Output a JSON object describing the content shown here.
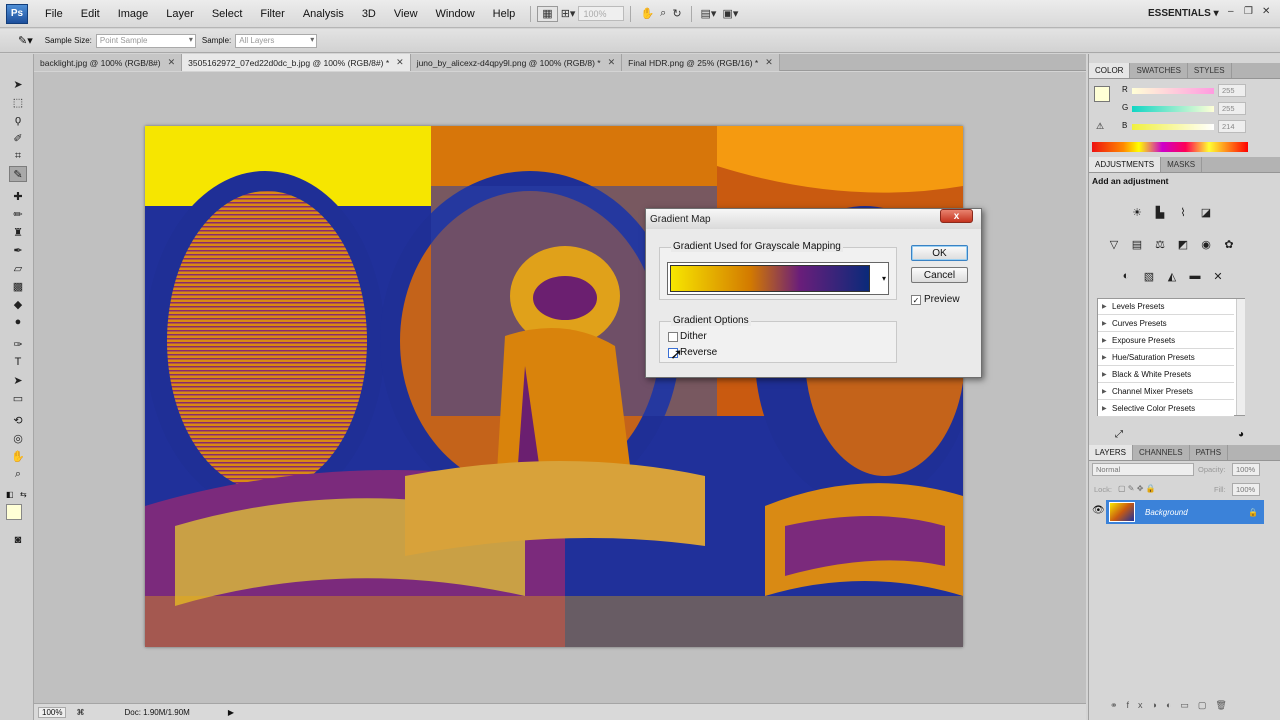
{
  "menubar": {
    "logo": "Ps",
    "items": [
      "File",
      "Edit",
      "Image",
      "Layer",
      "Select",
      "Filter",
      "Analysis",
      "3D",
      "View",
      "Window",
      "Help"
    ],
    "zoom_display": "100%",
    "workspace": "ESSENTIALS"
  },
  "options_bar": {
    "sample_size_label": "Sample Size:",
    "sample_size_value": "Point Sample",
    "sample_label": "Sample:",
    "sample_value": "All Layers"
  },
  "tabs": [
    {
      "label": "backlight.jpg @ 100% (RGB/8#)"
    },
    {
      "label": "3505162972_07ed22d0dc_b.jpg @ 100% (RGB/8#) *"
    },
    {
      "label": "juno_by_alicexz-d4qpy9l.png @ 100% (RGB/8) *"
    },
    {
      "label": "Final HDR.png @ 25% (RGB/16) *"
    }
  ],
  "status": {
    "zoom": "100%",
    "doc": "Doc: 1.90M/1.90M"
  },
  "color_panel": {
    "tabs": [
      "COLOR",
      "SWATCHES",
      "STYLES"
    ],
    "r_label": "R",
    "g_label": "G",
    "b_label": "B",
    "r": "255",
    "g": "255",
    "b": "214",
    "colors": {
      "fg": "#ffffd6",
      "r_grad": "#ff3b3b",
      "g_grad": "#3bd26a",
      "b_grad": "#ffe34a"
    }
  },
  "adjustments_panel": {
    "tabs": [
      "ADJUSTMENTS",
      "MASKS"
    ],
    "heading": "Add an adjustment",
    "presets": [
      "Levels Presets",
      "Curves Presets",
      "Exposure Presets",
      "Hue/Saturation Presets",
      "Black & White Presets",
      "Channel Mixer Presets",
      "Selective Color Presets"
    ]
  },
  "layers_panel": {
    "tabs": [
      "LAYERS",
      "CHANNELS",
      "PATHS"
    ],
    "blend_mode": "Normal",
    "opacity_label": "Opacity:",
    "opacity": "100%",
    "lock_label": "Lock:",
    "fill_label": "Fill:",
    "fill": "100%",
    "layers": [
      {
        "name": "Background"
      }
    ]
  },
  "dialog": {
    "title": "Gradient Map",
    "close": "x",
    "group_mapping": "Gradient Used for Grayscale Mapping",
    "group_options": "Gradient Options",
    "ok": "OK",
    "cancel": "Cancel",
    "preview_label": "Preview",
    "preview_checked": true,
    "dither_label": "Dither",
    "dither_checked": false,
    "reverse_label": "Reverse",
    "reverse_checked": false,
    "gradient_colors": [
      "#f7e600",
      "#d37a00",
      "#6a1e7a",
      "#0a2a7a"
    ]
  }
}
